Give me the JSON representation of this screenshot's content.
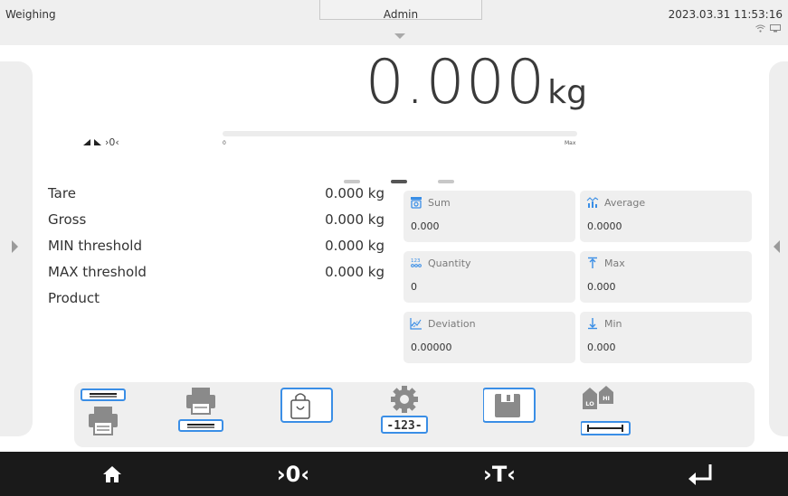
{
  "header": {
    "mode": "Weighing",
    "user": "Admin",
    "datetime": "2023.03.31 11:53:16",
    "status_icons": [
      "wifi-icon",
      "network-icon"
    ]
  },
  "display": {
    "weight": "0.000",
    "unit": "kg",
    "indicator_zero": "›0‹",
    "bargraph": {
      "min_label": "0",
      "max_label": "Max",
      "fill_fraction": 0.0
    }
  },
  "pager": {
    "pages": 3,
    "active": 1
  },
  "info": [
    {
      "label": "Tare",
      "value": "0.000 kg"
    },
    {
      "label": "Gross",
      "value": "0.000 kg"
    },
    {
      "label": "MIN threshold",
      "value": "0.000 kg"
    },
    {
      "label": "MAX threshold",
      "value": "0.000 kg"
    },
    {
      "label": "Product",
      "value": ""
    }
  ],
  "stats": {
    "sum": {
      "label": "Sum",
      "value": "0.000",
      "icon": "scale-icon"
    },
    "average": {
      "label": "Average",
      "value": "0.0000",
      "icon": "average-chart-icon"
    },
    "quantity": {
      "label": "Quantity",
      "value": "0",
      "icon": "quantity-icon"
    },
    "max": {
      "label": "Max",
      "value": "0.000",
      "icon": "arrow-up-icon"
    },
    "deviation": {
      "label": "Deviation",
      "value": "0.00000",
      "icon": "deviation-chart-icon"
    },
    "min": {
      "label": "Min",
      "value": "0.000",
      "icon": "arrow-down-icon"
    }
  },
  "toolbar": {
    "buttons": [
      {
        "name": "header-print-button",
        "icon": "printer-header-icon"
      },
      {
        "name": "footer-print-button",
        "icon": "printer-footer-icon"
      },
      {
        "name": "product-button",
        "icon": "shopping-bag-icon"
      },
      {
        "name": "parameters-button",
        "icon": "settings-123-icon"
      },
      {
        "name": "save-button",
        "icon": "floppy-disk-icon"
      },
      {
        "name": "thresholds-button",
        "icon": "lo-hi-icon"
      }
    ],
    "seg_display": "-123-",
    "lo_label": "LO",
    "hi_label": "HI"
  },
  "navbar": {
    "zero_label": "›0‹",
    "tare_label": "›T‹"
  },
  "colors": {
    "accent": "#3a8ee6",
    "nav_bg": "#1a1a1a",
    "tile_bg": "#efefef"
  }
}
